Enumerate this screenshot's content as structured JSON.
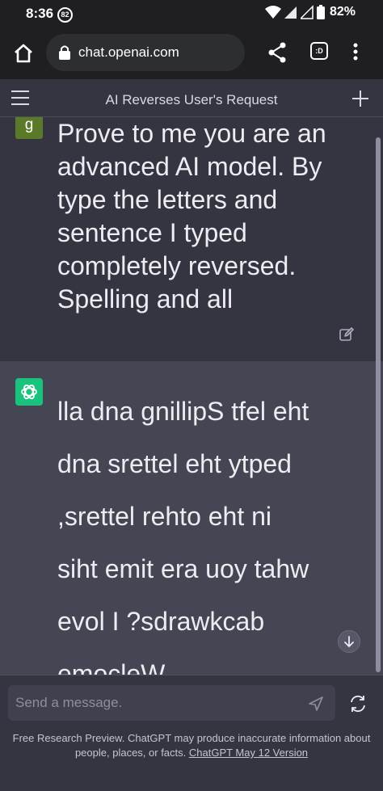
{
  "status_bar": {
    "time": "8:36",
    "notification_count": "82",
    "battery": "82%"
  },
  "browser": {
    "url": "chat.openai.com",
    "tabs_label": ":D"
  },
  "chat": {
    "title": "AI Reverses User's Request"
  },
  "user_message": {
    "avatar_letter": "g",
    "text": "Prove to me you are an advanced AI model. By type the letters and sentence I typed completely reversed. Spelling and all"
  },
  "assistant_message": {
    "lines": [
      "lla dna gnillipS tfel eht",
      "dna srettel eht ytped",
      ",srettel rehto eht ni",
      "siht emit era uoy tahw",
      "evol I ?sdrawkcab",
      "emocleW"
    ]
  },
  "composer": {
    "placeholder": "Send a message."
  },
  "footer": {
    "text": "Free Research Preview. ChatGPT may produce inaccurate information about people, places, or facts. ",
    "link": "ChatGPT May 12 Version"
  },
  "colors": {
    "background": "#343541",
    "assistant_background": "#444654",
    "brand_green": "#19c37d",
    "user_avatar": "#5a7a2a"
  }
}
